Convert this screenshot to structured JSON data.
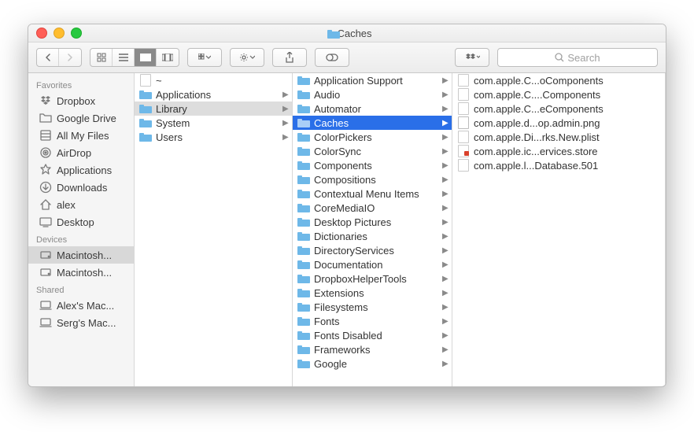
{
  "title": "Caches",
  "search_placeholder": "Search",
  "sidebar": {
    "sections": [
      {
        "header": "Favorites",
        "items": [
          {
            "icon": "dropbox",
            "label": "Dropbox"
          },
          {
            "icon": "folder",
            "label": "Google Drive"
          },
          {
            "icon": "allfiles",
            "label": "All My Files"
          },
          {
            "icon": "airdrop",
            "label": "AirDrop"
          },
          {
            "icon": "apps",
            "label": "Applications"
          },
          {
            "icon": "downloads",
            "label": "Downloads"
          },
          {
            "icon": "home",
            "label": "alex"
          },
          {
            "icon": "desktop",
            "label": "Desktop"
          }
        ]
      },
      {
        "header": "Devices",
        "items": [
          {
            "icon": "drive",
            "label": "Macintosh...",
            "selected": true
          },
          {
            "icon": "drive",
            "label": "Macintosh..."
          }
        ]
      },
      {
        "header": "Shared",
        "items": [
          {
            "icon": "computer",
            "label": "Alex's Mac..."
          },
          {
            "icon": "computer",
            "label": "Serg's Mac..."
          }
        ]
      }
    ]
  },
  "col1": [
    {
      "type": "file",
      "label": "~",
      "arrow": false
    },
    {
      "type": "folder",
      "label": "Applications",
      "arrow": true
    },
    {
      "type": "folder",
      "label": "Library",
      "arrow": true,
      "selected": true
    },
    {
      "type": "folder",
      "label": "System",
      "arrow": true
    },
    {
      "type": "folder",
      "label": "Users",
      "arrow": true
    }
  ],
  "col2": [
    {
      "type": "folder",
      "label": "Application Support",
      "arrow": true
    },
    {
      "type": "folder",
      "label": "Audio",
      "arrow": true
    },
    {
      "type": "folder",
      "label": "Automator",
      "arrow": true
    },
    {
      "type": "folder",
      "label": "Caches",
      "arrow": true,
      "selected": true
    },
    {
      "type": "folder",
      "label": "ColorPickers",
      "arrow": true
    },
    {
      "type": "folder",
      "label": "ColorSync",
      "arrow": true
    },
    {
      "type": "folder",
      "label": "Components",
      "arrow": true
    },
    {
      "type": "folder",
      "label": "Compositions",
      "arrow": true
    },
    {
      "type": "folder",
      "label": "Contextual Menu Items",
      "arrow": true
    },
    {
      "type": "folder",
      "label": "CoreMediaIO",
      "arrow": true
    },
    {
      "type": "folder",
      "label": "Desktop Pictures",
      "arrow": true
    },
    {
      "type": "folder",
      "label": "Dictionaries",
      "arrow": true
    },
    {
      "type": "folder",
      "label": "DirectoryServices",
      "arrow": true
    },
    {
      "type": "folder",
      "label": "Documentation",
      "arrow": true
    },
    {
      "type": "folder",
      "label": "DropboxHelperTools",
      "arrow": true
    },
    {
      "type": "folder",
      "label": "Extensions",
      "arrow": true
    },
    {
      "type": "folder",
      "label": "Filesystems",
      "arrow": true
    },
    {
      "type": "folder",
      "label": "Fonts",
      "arrow": true
    },
    {
      "type": "folder",
      "label": "Fonts Disabled",
      "arrow": true
    },
    {
      "type": "folder",
      "label": "Frameworks",
      "arrow": true
    },
    {
      "type": "folder",
      "label": "Google",
      "arrow": true
    }
  ],
  "col3": [
    {
      "type": "file",
      "label": "com.apple.C...oComponents"
    },
    {
      "type": "file",
      "label": "com.apple.C....Components"
    },
    {
      "type": "file",
      "label": "com.apple.C...eComponents"
    },
    {
      "type": "img",
      "label": "com.apple.d...op.admin.png"
    },
    {
      "type": "file",
      "label": "com.apple.Di...rks.New.plist"
    },
    {
      "type": "red",
      "label": "com.apple.ic...ervices.store"
    },
    {
      "type": "file",
      "label": "com.apple.l...Database.501"
    }
  ]
}
